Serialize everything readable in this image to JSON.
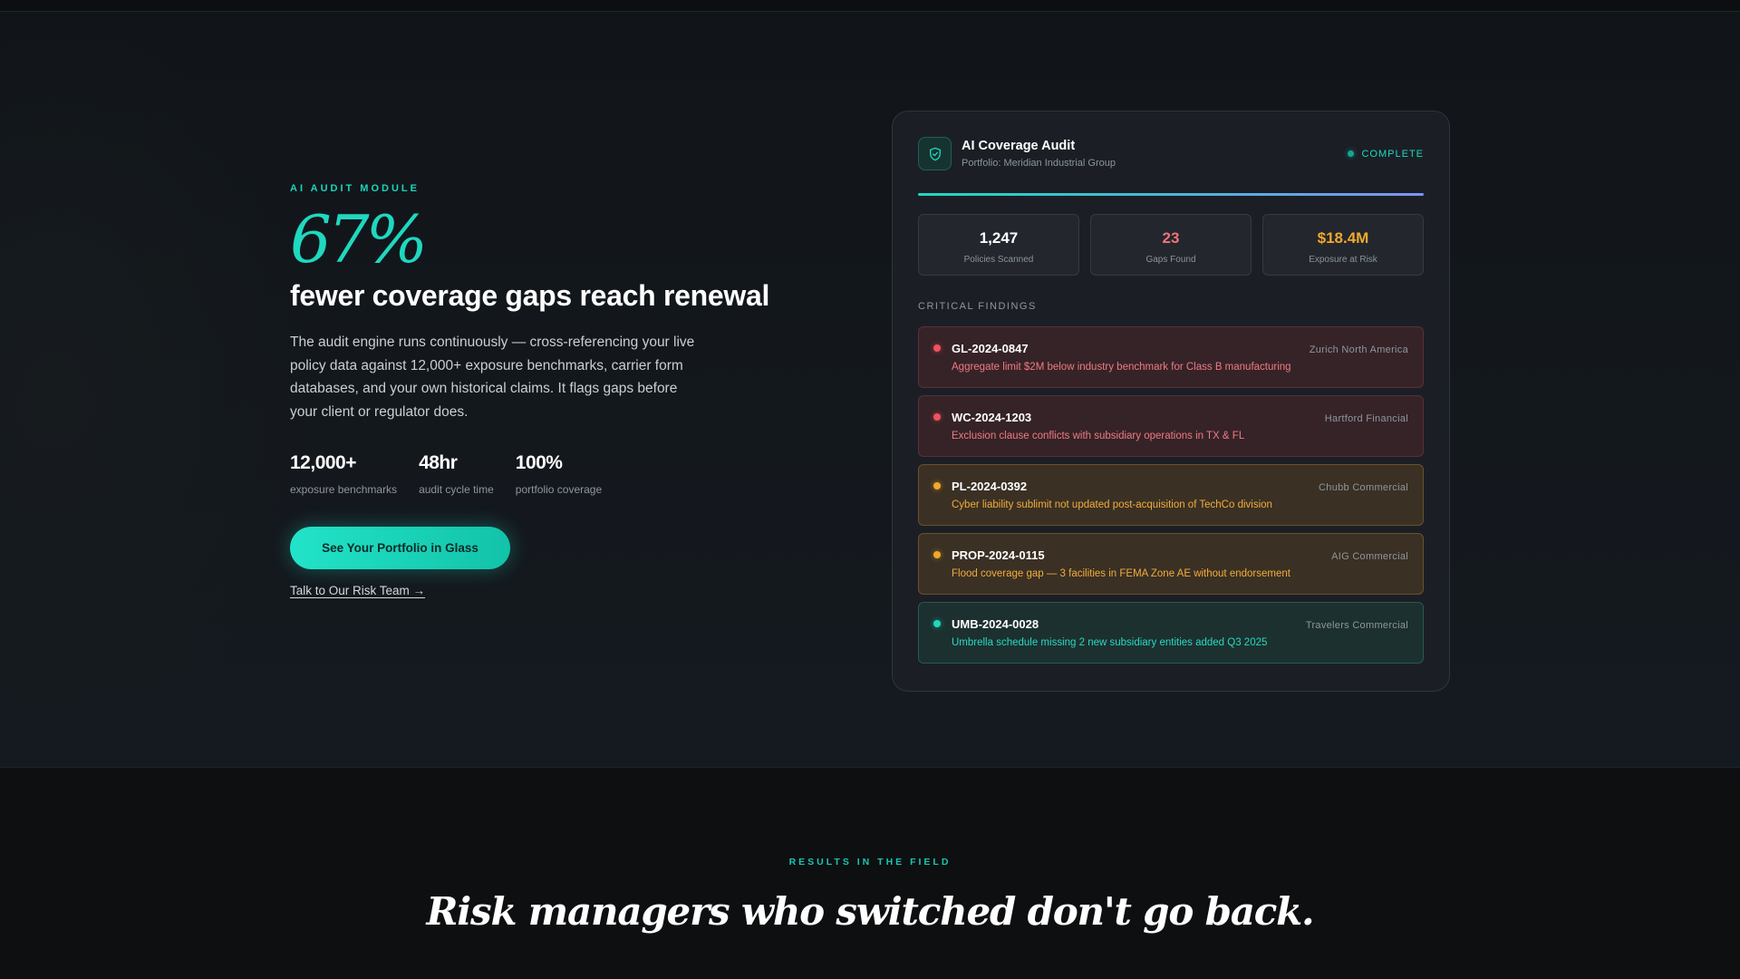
{
  "hero": {
    "eyebrow": "AI AUDIT MODULE",
    "big_stat": "67%",
    "headline": "fewer coverage gaps reach renewal",
    "body": "The audit engine runs continuously — cross-referencing your live policy data against 12,000+ exposure benchmarks, carrier form databases, and your own historical claims. It flags gaps before your client or regulator does.",
    "stats": [
      {
        "value": "12,000+",
        "label": "exposure benchmarks"
      },
      {
        "value": "48hr",
        "label": "audit cycle time"
      },
      {
        "value": "100%",
        "label": "portfolio coverage"
      }
    ],
    "cta_label": "See Your Portfolio in Glass",
    "secondary_link": "Talk to Our Risk Team →"
  },
  "audit_card": {
    "icon": "shield-check-icon",
    "title": "AI Coverage Audit",
    "subtitle": "Portfolio: Meridian Industrial Group",
    "status": "COMPLETE",
    "progress": 1.0,
    "metrics": [
      {
        "value": "1,247",
        "label": "Policies Scanned",
        "color": "#ffffff"
      },
      {
        "value": "23",
        "label": "Gaps Found",
        "color": "#f0727a"
      },
      {
        "value": "$18.4M",
        "label": "Exposure at Risk",
        "color": "#f2a82a"
      }
    ],
    "section_label": "CRITICAL FINDINGS",
    "findings": [
      {
        "id": "GL-2024-0847",
        "carrier": "Zurich North America",
        "desc": "Aggregate limit $2M below industry benchmark for Class B manufacturing",
        "severity": "red"
      },
      {
        "id": "WC-2024-1203",
        "carrier": "Hartford Financial",
        "desc": "Exclusion clause conflicts with subsidiary operations in TX & FL",
        "severity": "red"
      },
      {
        "id": "PL-2024-0392",
        "carrier": "Chubb Commercial",
        "desc": "Cyber liability sublimit not updated post-acquisition of TechCo division",
        "severity": "amber"
      },
      {
        "id": "PROP-2024-0115",
        "carrier": "AIG Commercial",
        "desc": "Flood coverage gap — 3 facilities in FEMA Zone AE without endorsement",
        "severity": "amber"
      },
      {
        "id": "UMB-2024-0028",
        "carrier": "Travelers Commercial",
        "desc": "Umbrella schedule missing 2 new subsidiary entities added Q3 2025",
        "severity": "teal"
      }
    ]
  },
  "results": {
    "eyebrow": "RESULTS IN THE FIELD",
    "title": "Risk managers who switched don't go back."
  },
  "colors": {
    "accent": "#1fd8bf",
    "critical": "#f0525d",
    "warning": "#f2a82a",
    "gradient_end": "#7f93f2"
  }
}
